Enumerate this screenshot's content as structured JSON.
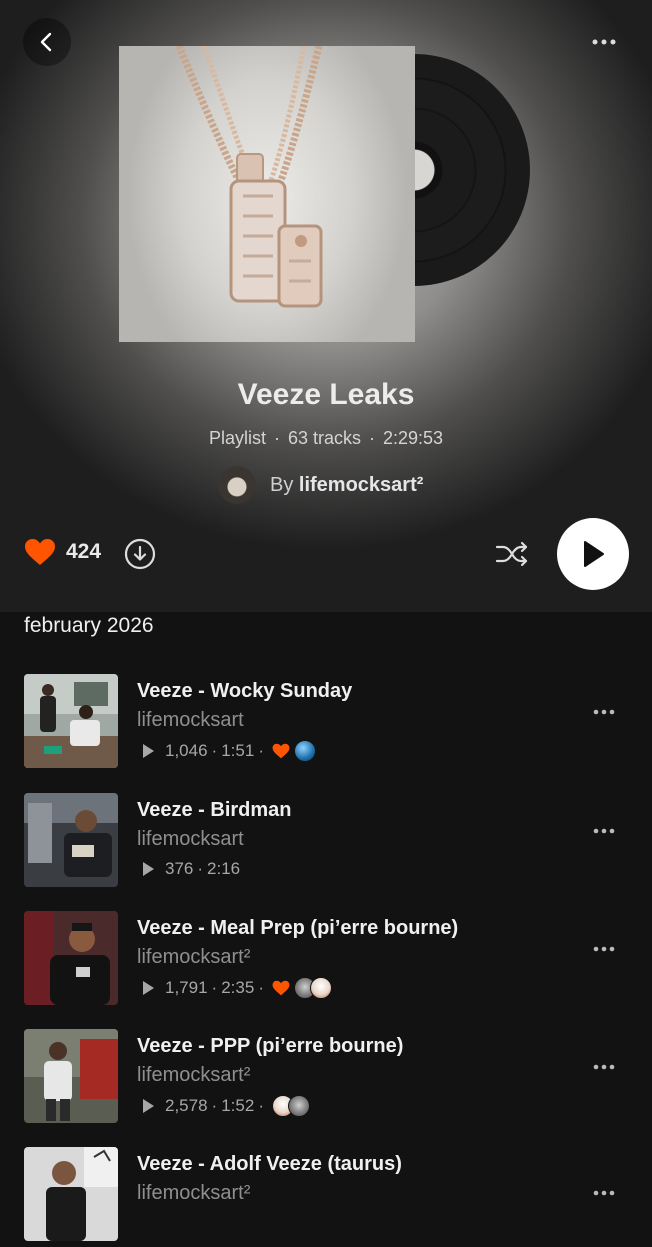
{
  "header": {
    "back_icon": "chevron-left-icon",
    "more_icon": "more-horizontal-icon"
  },
  "playlist": {
    "title": "Veeze Leaks",
    "type": "Playlist",
    "tracks_count": "63 tracks",
    "duration": "2:29:53",
    "by_label": "By",
    "author": "lifemocksart²"
  },
  "actions": {
    "like_count": "424",
    "like_icon": "heart-icon",
    "download_icon": "download-icon",
    "shuffle_icon": "shuffle-icon",
    "play_icon": "play-icon"
  },
  "section_label": "february 2026",
  "tracks": [
    {
      "title": "Veeze - Wocky Sunday",
      "artist": "lifemocksart",
      "plays": "1,046",
      "duration": "1:51",
      "liked": true,
      "reposters": [
        "blue-globe"
      ]
    },
    {
      "title": "Veeze - Birdman",
      "artist": "lifemocksart",
      "plays": "376",
      "duration": "2:16",
      "liked": false,
      "reposters": []
    },
    {
      "title": "Veeze - Meal Prep (pi’erre bourne)",
      "artist": "lifemocksart²",
      "plays": "1,791",
      "duration": "2:35",
      "liked": true,
      "reposters": [
        "grey",
        "white"
      ]
    },
    {
      "title": "Veeze - PPP (pi’erre bourne)",
      "artist": "lifemocksart²",
      "plays": "2,578",
      "duration": "1:52",
      "liked": false,
      "reposters": [
        "white",
        "grey"
      ]
    },
    {
      "title": "Veeze - Adolf Veeze (taurus)",
      "artist": "lifemocksart²",
      "plays": "",
      "duration": "",
      "liked": false,
      "reposters": []
    }
  ],
  "colors": {
    "accent": "#ff5500",
    "background": "#121212",
    "play_button_bg": "#ffffff"
  }
}
